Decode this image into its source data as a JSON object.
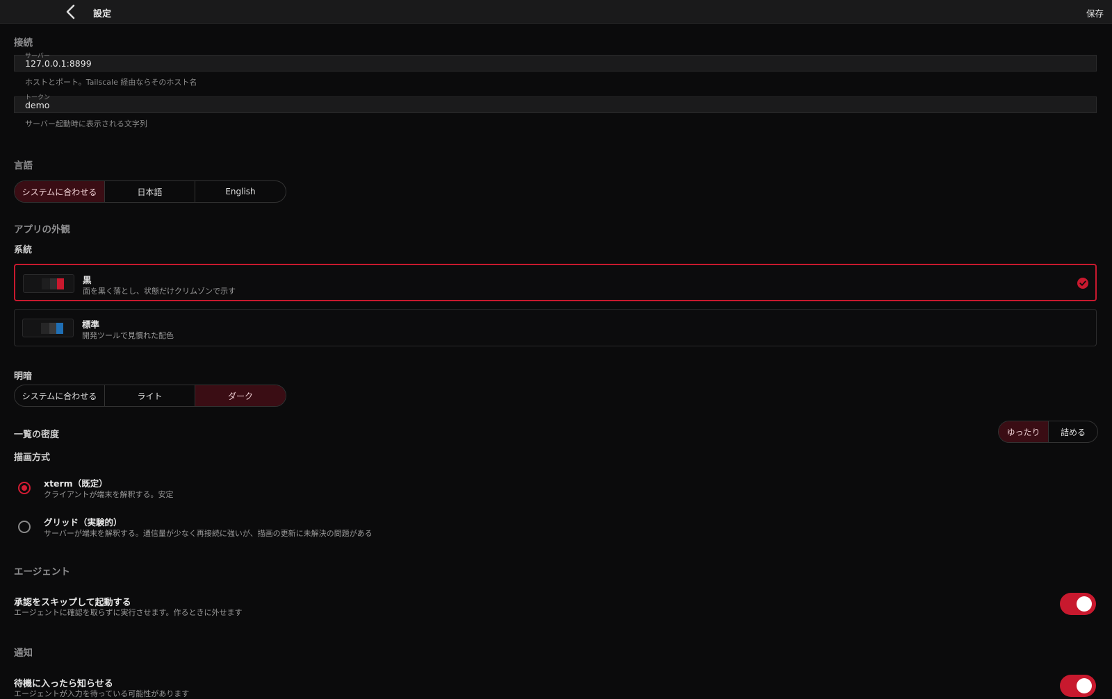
{
  "header": {
    "title": "設定",
    "save_label": "保存"
  },
  "connection": {
    "section_label": "接続",
    "server": {
      "label": "サーバー",
      "value": "127.0.0.1:8899",
      "hint": "ホストとポート。Tailscale 経由ならそのホスト名"
    },
    "token": {
      "label": "トークン",
      "value": "demo",
      "hint": "サーバー起動時に表示される文字列"
    }
  },
  "language": {
    "section_label": "言語",
    "options": [
      "システムに合わせる",
      "日本語",
      "English"
    ],
    "selected": "システムに合わせる"
  },
  "appearance": {
    "section_label": "アプリの外観",
    "family_label": "系統",
    "themes": [
      {
        "name": "黒",
        "desc": "面を黒く落とし、状態だけクリムゾンで示す",
        "selected": true,
        "accent": "#c8192e"
      },
      {
        "name": "標準",
        "desc": "開発ツールで見慣れた配色",
        "selected": false,
        "accent": "#1f6fb5"
      }
    ],
    "brightness_label": "明暗",
    "brightness_options": [
      "システムに合わせる",
      "ライト",
      "ダーク"
    ],
    "brightness_selected": "ダーク",
    "density_label": "一覧の密度",
    "density_options": [
      "ゆったり",
      "詰める"
    ],
    "density_selected": "ゆったり",
    "render_label": "描画方式",
    "render_options": [
      {
        "title": "xterm（既定）",
        "desc": "クライアントが端末を解釈する。安定",
        "selected": true
      },
      {
        "title": "グリッド（実験的）",
        "desc": "サーバーが端末を解釈する。通信量が少なく再接続に強いが、描画の更新に未解決の問題がある",
        "selected": false
      }
    ]
  },
  "agent": {
    "section_label": "エージェント",
    "skip_approval": {
      "title": "承認をスキップして起動する",
      "desc": "エージェントに確認を取らずに実行させます。作るときに外せます",
      "enabled": true
    }
  },
  "notification": {
    "section_label": "通知",
    "idle_notify": {
      "title": "待機に入ったら知らせる",
      "desc": "エージェントが入力を待っている可能性があります",
      "enabled": true
    }
  },
  "colors": {
    "accent": "#c8192e",
    "active_segment_bg": "#3a0d14",
    "background": "#0b0b0c"
  },
  "icons": {
    "back": "chevron-left-icon",
    "check": "check-circle-icon"
  }
}
